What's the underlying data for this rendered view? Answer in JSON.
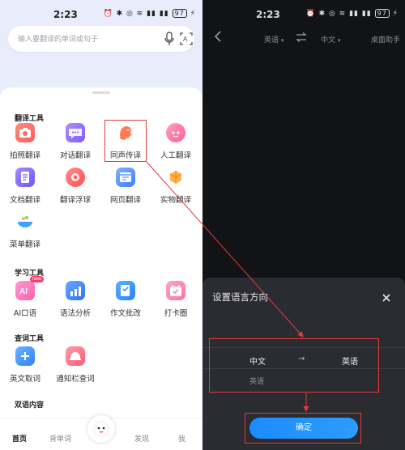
{
  "left": {
    "status": {
      "time": "2:23",
      "battery": "97"
    },
    "search": {
      "placeholder": "输入要翻译的单词或句子"
    },
    "sections": [
      {
        "title": "翻译工具"
      },
      {
        "title": "学习工具"
      },
      {
        "title": "查词工具"
      },
      {
        "title": "双语内容"
      }
    ],
    "translate_tools": [
      {
        "label": "拍照翻译",
        "icon": "camera-icon"
      },
      {
        "label": "对话翻译",
        "icon": "chat-bubble-icon"
      },
      {
        "label": "同声传译",
        "icon": "head-speaking-icon"
      },
      {
        "label": "人工翻译",
        "icon": "human-translator-icon"
      },
      {
        "label": "文档翻译",
        "icon": "document-icon"
      },
      {
        "label": "翻译浮球",
        "icon": "floating-ball-icon"
      },
      {
        "label": "网页翻译",
        "icon": "webpage-icon"
      },
      {
        "label": "实物翻译",
        "icon": "object-icon"
      },
      {
        "label": "菜单翻译",
        "icon": "menu-bowl-icon"
      }
    ],
    "learning_tools": [
      {
        "label": "AI口语",
        "icon": "ai-speaking-icon",
        "badge": "new"
      },
      {
        "label": "语法分析",
        "icon": "grammar-chart-icon"
      },
      {
        "label": "作文批改",
        "icon": "essay-correction-icon"
      },
      {
        "label": "打卡圈",
        "icon": "calendar-checkin-icon"
      }
    ],
    "lookup_tools": [
      {
        "label": "英文取词",
        "icon": "word-pick-icon"
      },
      {
        "label": "通知栏查词",
        "icon": "notification-lookup-icon"
      }
    ],
    "bottom_nav": [
      {
        "label": "首页",
        "active": true
      },
      {
        "label": "背单词",
        "active": false
      },
      {
        "label": "发现",
        "active": false
      },
      {
        "label": "我",
        "active": false
      }
    ]
  },
  "right": {
    "status": {
      "time": "2:23",
      "battery": "97"
    },
    "topbar": {
      "source_lang": "英语",
      "target_lang": "中文",
      "desk_helper": "桌面助手"
    },
    "dialog": {
      "title": "设置语言方向",
      "from": "中文",
      "arrow": "→",
      "to": "英语",
      "option": "英语",
      "confirm": "确定"
    }
  },
  "colors": {
    "highlight": "#e23b3b",
    "accent_blue": "#1b8cff",
    "dark_bg": "#121316",
    "dialog_bg": "#2b2c31"
  }
}
